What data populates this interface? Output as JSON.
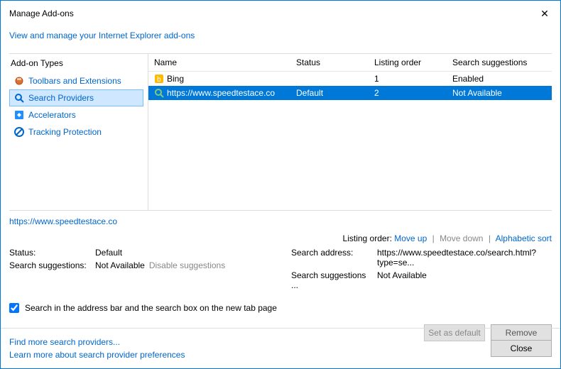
{
  "window": {
    "title": "Manage Add-ons",
    "close_glyph": "✕"
  },
  "subheader": {
    "link": "View and manage your Internet Explorer add-ons"
  },
  "sidebar": {
    "heading": "Add-on Types",
    "items": [
      {
        "label": "Toolbars and Extensions"
      },
      {
        "label": "Search Providers"
      },
      {
        "label": "Accelerators"
      },
      {
        "label": "Tracking Protection"
      }
    ]
  },
  "table": {
    "headers": [
      "Name",
      "Status",
      "Listing order",
      "Search suggestions"
    ],
    "rows": [
      {
        "name": "Bing",
        "status": "",
        "order": "1",
        "sugg": "Enabled"
      },
      {
        "name": "https://www.speedtestace.co",
        "status": "Default",
        "order": "2",
        "sugg": "Not Available"
      }
    ]
  },
  "details": {
    "title": "https://www.speedtestace.co",
    "listing_label": "Listing order:",
    "move_up": "Move up",
    "move_down": "Move down",
    "alpha_sort": "Alphabetic sort",
    "left": {
      "status_k": "Status:",
      "status_v": "Default",
      "sugg_k": "Search suggestions:",
      "sugg_v": "Not Available",
      "disable": "Disable suggestions"
    },
    "right": {
      "addr_k": "Search address:",
      "addr_v": "https://www.speedtestace.co/search.html?type=se...",
      "sugg_k": "Search suggestions ...",
      "sugg_v": "Not Available"
    }
  },
  "checkbox": {
    "label": "Search in the address bar and the search box on the new tab page"
  },
  "buttons": {
    "set_default": "Set as default",
    "remove": "Remove",
    "close": "Close"
  },
  "footer": {
    "find": "Find more search providers...",
    "learn": "Learn more about search provider preferences"
  }
}
